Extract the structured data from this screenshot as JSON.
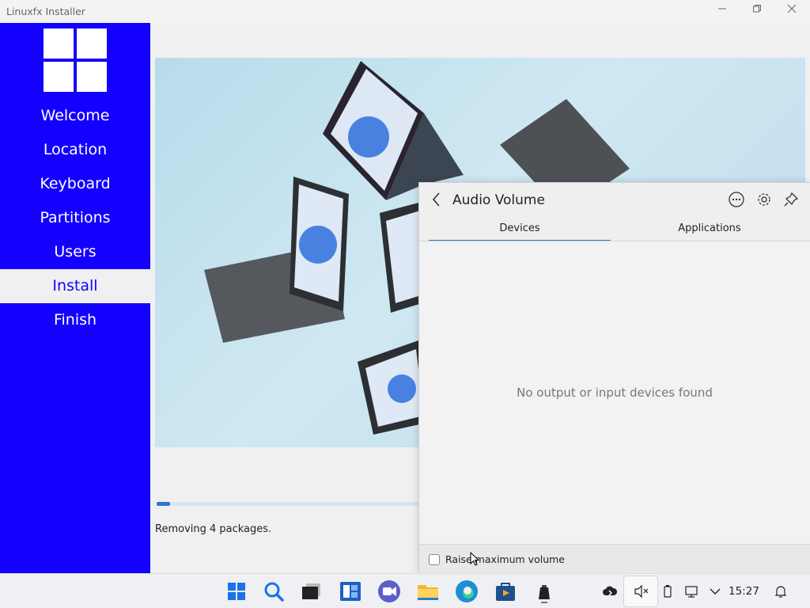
{
  "window": {
    "title": "Linuxfx Installer"
  },
  "sidebar": {
    "items": [
      {
        "label": "Welcome"
      },
      {
        "label": "Location"
      },
      {
        "label": "Keyboard"
      },
      {
        "label": "Partitions"
      },
      {
        "label": "Users"
      },
      {
        "label": "Install"
      },
      {
        "label": "Finish"
      }
    ],
    "active": "Install"
  },
  "main": {
    "status": "Removing 4 packages.",
    "progress_fraction": 0.02
  },
  "audio_flyout": {
    "title": "Audio Volume",
    "tabs": [
      {
        "label": "Devices",
        "active": true
      },
      {
        "label": "Applications",
        "active": false
      }
    ],
    "empty_message": "No output or input devices found",
    "raise_max_label": "Raise maximum volume",
    "raise_max_checked": false
  },
  "taskbar": {
    "clock": "15:27",
    "apps": [
      "windows-start-icon",
      "search-icon",
      "terminal-icon",
      "widgets-icon",
      "meet-icon",
      "file-explorer-icon",
      "edge-browser-icon",
      "store-icon",
      "usb-stick-icon"
    ],
    "tray": [
      "cloud-sync-icon",
      "speaker-muted-icon",
      "battery-icon",
      "network-icon",
      "chevron-up-icon",
      "bell-icon"
    ]
  },
  "colors": {
    "sidebar_bg": "#1400ff",
    "accent": "#2f77cc"
  }
}
